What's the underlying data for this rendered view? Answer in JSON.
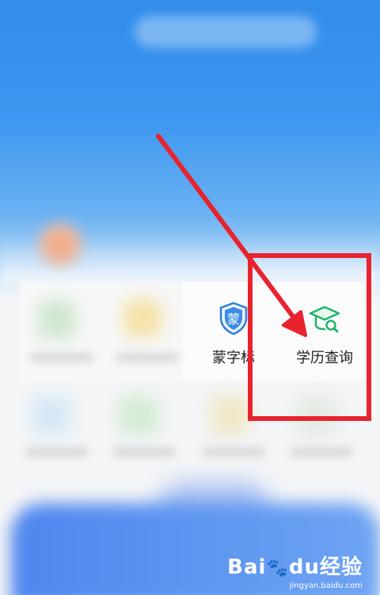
{
  "services": [
    {
      "label": "蒙字标",
      "icon": "shield-meng-icon",
      "icon_text": "蒙",
      "color": "#2f7fd9"
    },
    {
      "label": "学历查询",
      "icon": "graduation-cap-search-icon",
      "color": "#1fb36a"
    }
  ],
  "annotation": {
    "color": "#e8232e"
  },
  "watermark": {
    "brand": "Bai",
    "paw": "du",
    "suffix": "经验",
    "url": "jingyan.baidu.com"
  }
}
